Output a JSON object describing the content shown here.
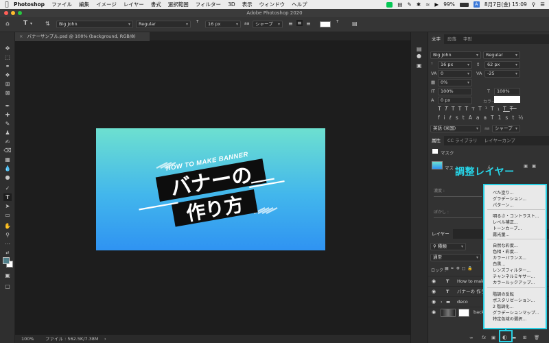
{
  "menubar": {
    "app": "Photoshop",
    "items": [
      "ファイル",
      "編集",
      "イメージ",
      "レイヤー",
      "書式",
      "選択範囲",
      "フィルター",
      "3D",
      "表示",
      "ウィンドウ",
      "ヘルプ"
    ],
    "battery": "99%",
    "date_time": "8月7日(金)  15:09"
  },
  "window": {
    "title": "Adobe Photoshop 2020"
  },
  "options_bar": {
    "font_family": "Big John",
    "font_style": "Regular",
    "font_size": "16 px",
    "antialias": "シャープ"
  },
  "document_tab": {
    "label": "バナーサンプル.psd @ 100% (background, RGB/8)"
  },
  "banner": {
    "subtitle": "HOW TO MAKE BANNER",
    "line1": "バナーの",
    "line2": "作り方"
  },
  "status_bar": {
    "zoom": "100%",
    "file_info": "ファイル : 562.5K/7.38M"
  },
  "character_panel": {
    "tabs": [
      "文字",
      "段落",
      "字形"
    ],
    "font_family": "Big John",
    "font_style": "Regular",
    "font_size": "16 px",
    "leading": "62 px",
    "kerning": "0",
    "tracking": "-25",
    "tsume": "0%",
    "vertical_scale": "100%",
    "horizontal_scale": "100%",
    "baseline_shift": "0 px",
    "color_label": "カラー :",
    "language": "英語 (米国)",
    "antialias": "シャープ"
  },
  "properties_panel": {
    "tabs": [
      "属性",
      "CC ライブラリ",
      "レイヤーカンプ"
    ],
    "mask_label": "マスク",
    "mask_preview_label": "マス",
    "partial_text": "ん",
    "density_label": "濃度 :",
    "feather_label": "ぼかし :"
  },
  "layers_panel": {
    "tab": "レイヤー",
    "filter": "種類",
    "blend_mode": "通常",
    "lock_label": "ロック :",
    "layers": [
      {
        "type": "text",
        "name": "How to make"
      },
      {
        "type": "text",
        "name": "バナーの 作り方"
      },
      {
        "type": "group",
        "name": "deco"
      },
      {
        "type": "image",
        "name": "back"
      }
    ]
  },
  "callout": {
    "label": "調整レイヤー",
    "accent": "#27d5e8"
  },
  "adjustment_menu": {
    "groups": [
      [
        "べた塗り...",
        "グラデーション...",
        "パターン..."
      ],
      [
        "明るさ・コントラスト...",
        "レベル補正...",
        "トーンカーブ...",
        "露光量..."
      ],
      [
        "自然な彩度...",
        "色相・彩度...",
        "カラーバランス...",
        "白黒...",
        "レンズフィルター...",
        "チャンネルミキサー...",
        "カラールックアップ..."
      ],
      [
        "階調の反転",
        "ポスタリゼーション...",
        "2 階調化...",
        "グラデーションマップ...",
        "特定色域の選択..."
      ]
    ]
  },
  "colors": {
    "banner_top": "#6de0d0",
    "banner_bottom": "#2f93f2",
    "text_black": "#0d0d0d"
  }
}
